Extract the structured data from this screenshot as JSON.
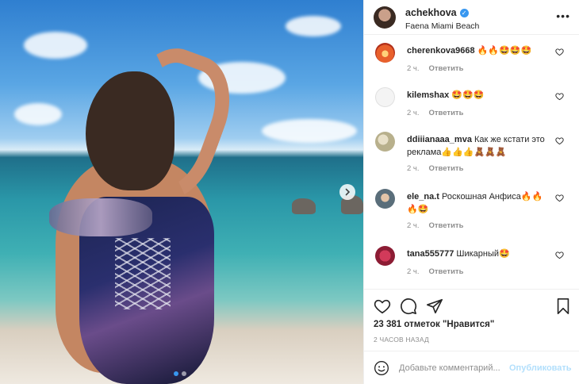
{
  "post": {
    "username": "achekhova",
    "location": "Faena Miami Beach",
    "more_icon": "more-horizontal-icon",
    "verified_icon": "verified-badge-icon"
  },
  "comments": [
    {
      "username": "cherenkova9668",
      "text": "🔥🔥🤩🤩🤩",
      "time": "2 ч.",
      "reply": "Ответить"
    },
    {
      "username": "kilemshax",
      "text": "🤩🤩🤩",
      "time": "2 ч.",
      "reply": "Ответить"
    },
    {
      "username": "ddiiianaaa_mva",
      "text": "Как же кстати это реклама👍👍👍🧸🧸🧸",
      "time": "2 ч.",
      "reply": "Ответить"
    },
    {
      "username": "ele_na.t",
      "text": "Роскошная Анфиса🔥🔥🔥🤩",
      "time": "2 ч.",
      "reply": "Ответить"
    },
    {
      "username": "tana555777",
      "text": "Шикарный🤩",
      "time": "2 ч.",
      "reply": "Ответить"
    }
  ],
  "actions": {
    "likes": "23 381 отметок \"Нравится\"",
    "time_ago": "2 ЧАСОВ НАЗАД"
  },
  "add_comment": {
    "placeholder": "Добавьте комментарий...",
    "publish": "Опубликовать"
  },
  "colors": {
    "accent": "#3897f0",
    "publish_disabled": "#b2dffc",
    "muted": "#8e8e8e"
  },
  "carousel": {
    "current": 1,
    "total": 2
  }
}
